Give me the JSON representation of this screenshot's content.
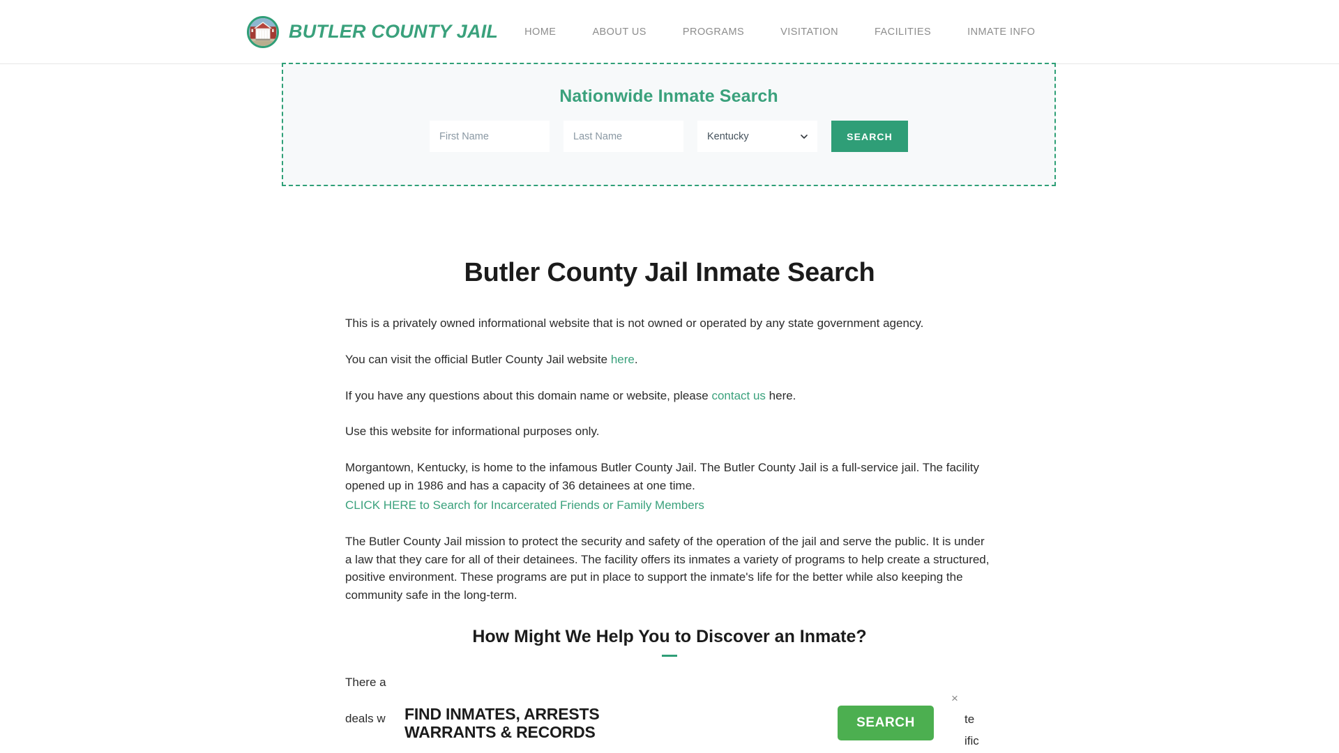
{
  "header": {
    "brand_name": "BUTLER COUNTY JAIL",
    "logo_icon": "courthouse-logo-icon",
    "nav": [
      {
        "label": "HOME"
      },
      {
        "label": "ABOUT US"
      },
      {
        "label": "PROGRAMS"
      },
      {
        "label": "VISITATION"
      },
      {
        "label": "FACILITIES"
      },
      {
        "label": "INMATE INFO"
      }
    ]
  },
  "search_widget": {
    "title": "Nationwide Inmate Search",
    "first_name_placeholder": "First Name",
    "last_name_placeholder": "Last Name",
    "first_name_value": "",
    "last_name_value": "",
    "state_selected": "Kentucky",
    "state_options": [
      "Kentucky"
    ],
    "search_label": "SEARCH",
    "accent_color": "#2f9e77",
    "border_style": "dashed"
  },
  "article": {
    "title": "Butler County Jail Inmate Search",
    "p1": "This is a privately owned informational website that is not owned or operated by any state government agency.",
    "p2_before": "You can visit the official Butler County Jail website ",
    "p2_link": "here",
    "p2_after": ".",
    "p3_before": "If you have any questions about this domain name or website, please ",
    "p3_link": "contact us",
    "p3_after": " here.",
    "p4": "Use this website for informational purposes only.",
    "p5": "Morgantown, Kentucky, is home to the infamous Butler County Jail. The Butler County Jail is a full-service jail. The facility opened up in 1986 and has a capacity of 36 detainees at one time.",
    "cta": "CLICK HERE to Search for Incarcerated Friends or Family Members",
    "p6": "The Butler County Jail mission to protect the security and safety of the operation of the jail and serve the public. It is under a law that they care for all of their detainees. The facility offers its inmates a variety of programs to help create a structured, positive environment. These programs are put in place to support the inmate's life for the better while also keeping the community safe in the long-term.",
    "section_heading": "How Might We Help You to Discover an Inmate?",
    "p7_start": "There a",
    "p7_start2": "deals w",
    "p7_end1": "te",
    "p7_end2": "ific",
    "link_color": "#3aa17c"
  },
  "ad": {
    "headline_line1": "FIND INMATES, ARRESTS",
    "headline_line2": "WARRANTS & RECORDS",
    "search_label": "SEARCH",
    "close_label": "×",
    "button_color": "#4caf50"
  }
}
